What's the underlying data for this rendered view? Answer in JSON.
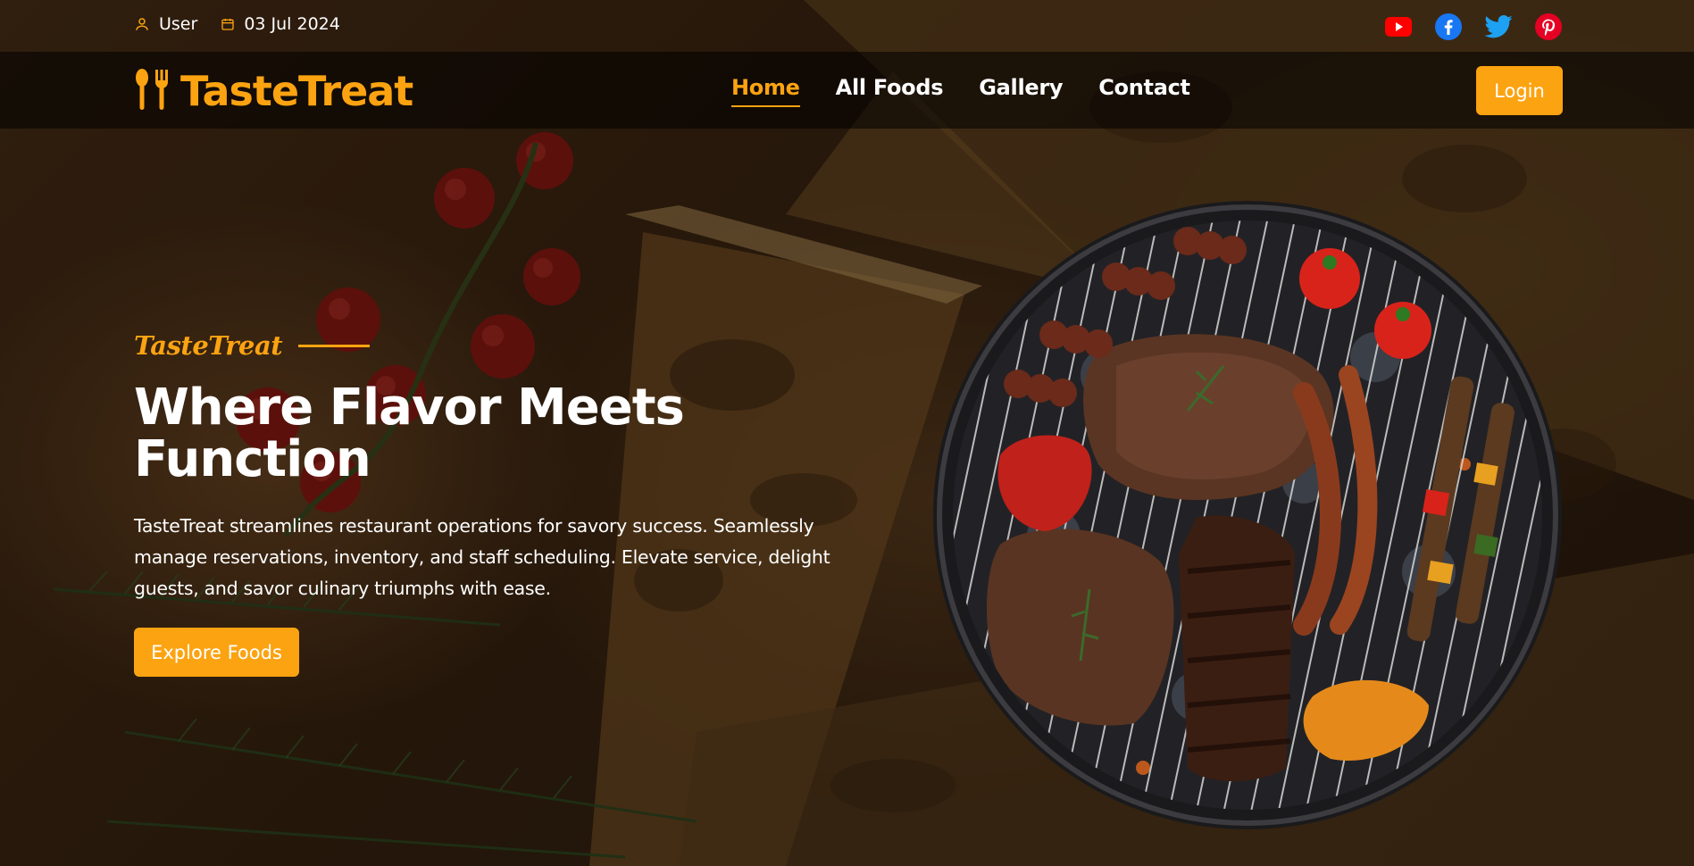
{
  "topbar": {
    "user_label": "User",
    "date_label": "03 Jul 2024",
    "user_icon": "user-icon",
    "date_icon": "calendar-icon",
    "socials": [
      {
        "name": "youtube-icon",
        "color": "#ff0000"
      },
      {
        "name": "facebook-icon",
        "color": "#1877f2"
      },
      {
        "name": "twitter-icon",
        "color": "#1da1f2"
      },
      {
        "name": "pinterest-icon",
        "color": "#e60023"
      }
    ]
  },
  "nav": {
    "brand": "TasteTreat",
    "brand_icon": "fork-spoon-icon",
    "links": [
      "Home",
      "All Foods",
      "Gallery",
      "Contact"
    ],
    "active_link": "Home",
    "login_label": "Login"
  },
  "hero": {
    "tagline": "TasteTreat",
    "title": "Where Flavor Meets Function",
    "description": "TasteTreat streamlines restaurant operations for savory success. Seamlessly manage reservations, inventory, and staff scheduling. Elevate service, delight guests, and savor culinary triumphs with ease.",
    "cta_label": "Explore Foods"
  },
  "colors": {
    "accent": "#fca311",
    "text": "#ffffff"
  }
}
